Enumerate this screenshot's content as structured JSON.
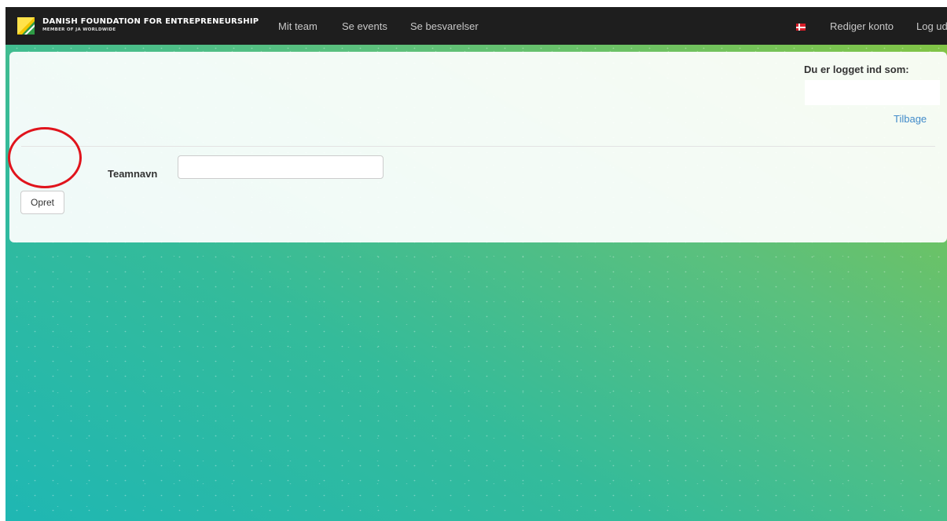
{
  "brand": {
    "title": "DANISH FOUNDATION FOR ENTREPRENEURSHIP",
    "subtitle": "MEMBER OF JA WORLDWIDE",
    "logo_icon": "foundation-logo-icon"
  },
  "nav": {
    "links": [
      {
        "label": "Mit team"
      },
      {
        "label": "Se events"
      },
      {
        "label": "Se besvarelser"
      }
    ],
    "right": {
      "flag_icon": "danish-flag-icon",
      "edit_account": "Rediger konto",
      "logout": "Log ud"
    }
  },
  "account": {
    "logged_in_label": "Du er logget ind som:",
    "username": "",
    "back_link": "Tilbage"
  },
  "form": {
    "team_name_label": "Teamnavn",
    "team_name_value": "",
    "create_button": "Opret"
  },
  "colors": {
    "navbar": "#1e1e1e",
    "gradient_start": "#1fb7b3",
    "gradient_end": "#86c53f",
    "link": "#428bca",
    "highlight": "#e0141c"
  }
}
